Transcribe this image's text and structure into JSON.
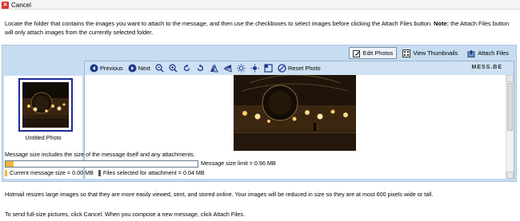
{
  "topbar": {
    "cancel_label": "Cancel"
  },
  "intro": {
    "text": "Locate the folder that contains the images you want to attach to the message, and then use the checkboxes to select images before clicking the Attach Files button.",
    "note_label": "Note:",
    "note_text": "the Attach Files button will only attach images from the currently selected folder."
  },
  "tabs": [
    {
      "label": "Edit Photos",
      "icon": "edit-photos-icon",
      "active": true
    },
    {
      "label": "View Thumbnails",
      "icon": "view-thumbnails-icon",
      "active": false
    },
    {
      "label": "Attach Files",
      "icon": "attach-files-icon",
      "active": false
    }
  ],
  "thumbnail": {
    "label": "Untitled Photo",
    "selected": true
  },
  "toolbar": {
    "previous_label": "Previous",
    "next_label": "Next",
    "reset_label": "Reset Photo",
    "brand": "MESS.BE",
    "tools": [
      "zoom-out-icon",
      "zoom-in-icon",
      "rotate-left-icon",
      "rotate-right-icon",
      "flip-horizontal-icon",
      "flip-vertical-icon",
      "brightness-icon",
      "contrast-icon",
      "crop-icon"
    ]
  },
  "size": {
    "info": "Message size includes the size of the message itself and any attachments.",
    "limit_label": "Message size limit = 0.96 MB",
    "fill_fraction": 0.04,
    "current_label": "Current message size = 0.00 MB",
    "selected_label": "Files selected for attachment = 0.04 MB",
    "colors": {
      "current": "#f2b43c",
      "selected": "#5a5a5a"
    }
  },
  "footer": {
    "line1": "Hotmail resizes large images so that they are more easily viewed, sent, and stored online. Your images will be reduced in size so they are at most 600 pixels wide or tall.",
    "line2": "To send full-size pictures, click Cancel. When you compose a new message, click Attach Files."
  }
}
